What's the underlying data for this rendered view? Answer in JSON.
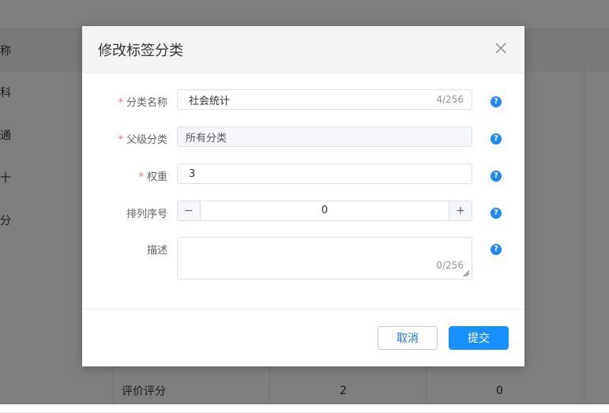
{
  "background_table": {
    "header_label": "称",
    "rows": [
      {
        "left": "科"
      },
      {
        "left": "通"
      },
      {
        "left": "十"
      },
      {
        "left": "分"
      },
      {
        "left": ""
      },
      {
        "left": ""
      },
      {
        "left": ""
      }
    ],
    "last_row": {
      "name": "评价评分",
      "col_a": "2",
      "col_b": "0"
    }
  },
  "dialog": {
    "title": "修改标签分类",
    "fields": {
      "category_name": {
        "label": "分类名称",
        "required": "*",
        "value": "社会统计",
        "count": "4/256"
      },
      "parent_category": {
        "label": "父级分类",
        "required": "*",
        "value": "所有分类"
      },
      "weight": {
        "label": "权重",
        "required": "*",
        "value": "3"
      },
      "sort_order": {
        "label": "排列序号",
        "value": "0",
        "minus": "−",
        "plus": "+"
      },
      "description": {
        "label": "描述",
        "value": "",
        "count": "0/256"
      }
    },
    "help_glyph": "?",
    "buttons": {
      "cancel": "取消",
      "submit": "提交"
    }
  },
  "colors": {
    "primary": "#1890ff",
    "required": "#f56c6c",
    "help": "#1e88f5"
  }
}
